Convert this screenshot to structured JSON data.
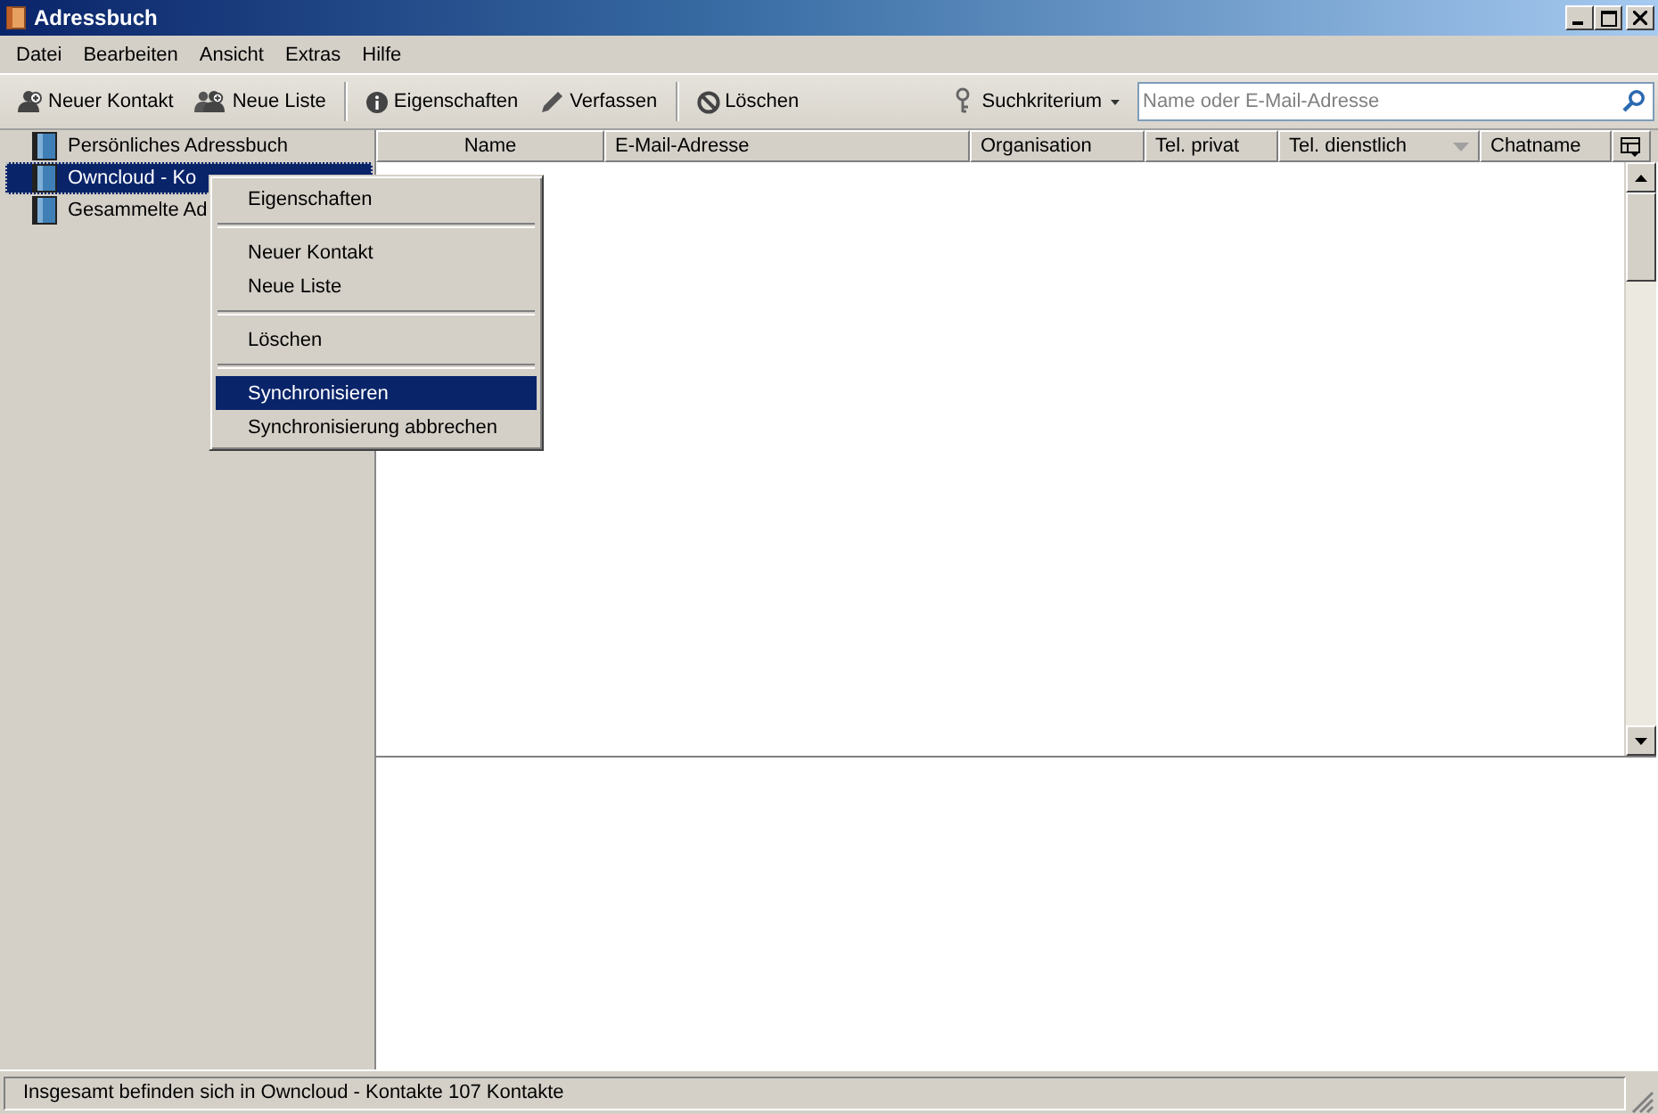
{
  "window": {
    "title": "Adressbuch"
  },
  "menu_bar": [
    "Datei",
    "Bearbeiten",
    "Ansicht",
    "Extras",
    "Hilfe"
  ],
  "toolbar": {
    "buttons": [
      {
        "kind": "new-contact",
        "label": "Neuer Kontakt"
      },
      {
        "kind": "new-list",
        "label": "Neue Liste"
      },
      {
        "kind": "separator"
      },
      {
        "kind": "properties",
        "label": "Eigenschaften"
      },
      {
        "kind": "compose",
        "label": "Verfassen"
      },
      {
        "kind": "separator"
      },
      {
        "kind": "delete",
        "label": "Löschen"
      }
    ],
    "search_criteria": "Suchkriterium",
    "search": {
      "placeholder": "Name oder E-Mail-Adresse"
    }
  },
  "sidebar": {
    "items": [
      {
        "label": "Persönliches Adressbuch",
        "selected": false
      },
      {
        "label": "Owncloud - Ko",
        "selected": true
      },
      {
        "label": "Gesammelte Ad",
        "selected": false
      }
    ]
  },
  "table": {
    "columns": [
      {
        "label": "Name",
        "sorted": false
      },
      {
        "label": "E-Mail-Adresse",
        "sorted": false
      },
      {
        "label": "Organisation",
        "sorted": false
      },
      {
        "label": "Tel. privat",
        "sorted": false
      },
      {
        "label": "Tel. dienstlich",
        "sorted": true
      },
      {
        "label": "Chatname",
        "sorted": false
      }
    ]
  },
  "context_menu": {
    "items": [
      {
        "kind": "item",
        "label": "Eigenschaften",
        "selected": false
      },
      {
        "kind": "separator"
      },
      {
        "kind": "item",
        "label": "Neuer Kontakt",
        "selected": false
      },
      {
        "kind": "item",
        "label": "Neue Liste",
        "selected": false
      },
      {
        "kind": "separator"
      },
      {
        "kind": "item",
        "label": "Löschen",
        "selected": false
      },
      {
        "kind": "separator"
      },
      {
        "kind": "item",
        "label": "Synchronisieren",
        "selected": true
      },
      {
        "kind": "item",
        "label": "Synchronisierung abbrechen",
        "selected": false
      }
    ]
  },
  "status_bar": "Insgesamt befinden sich in Owncloud - Kontakte 107 Kontakte"
}
